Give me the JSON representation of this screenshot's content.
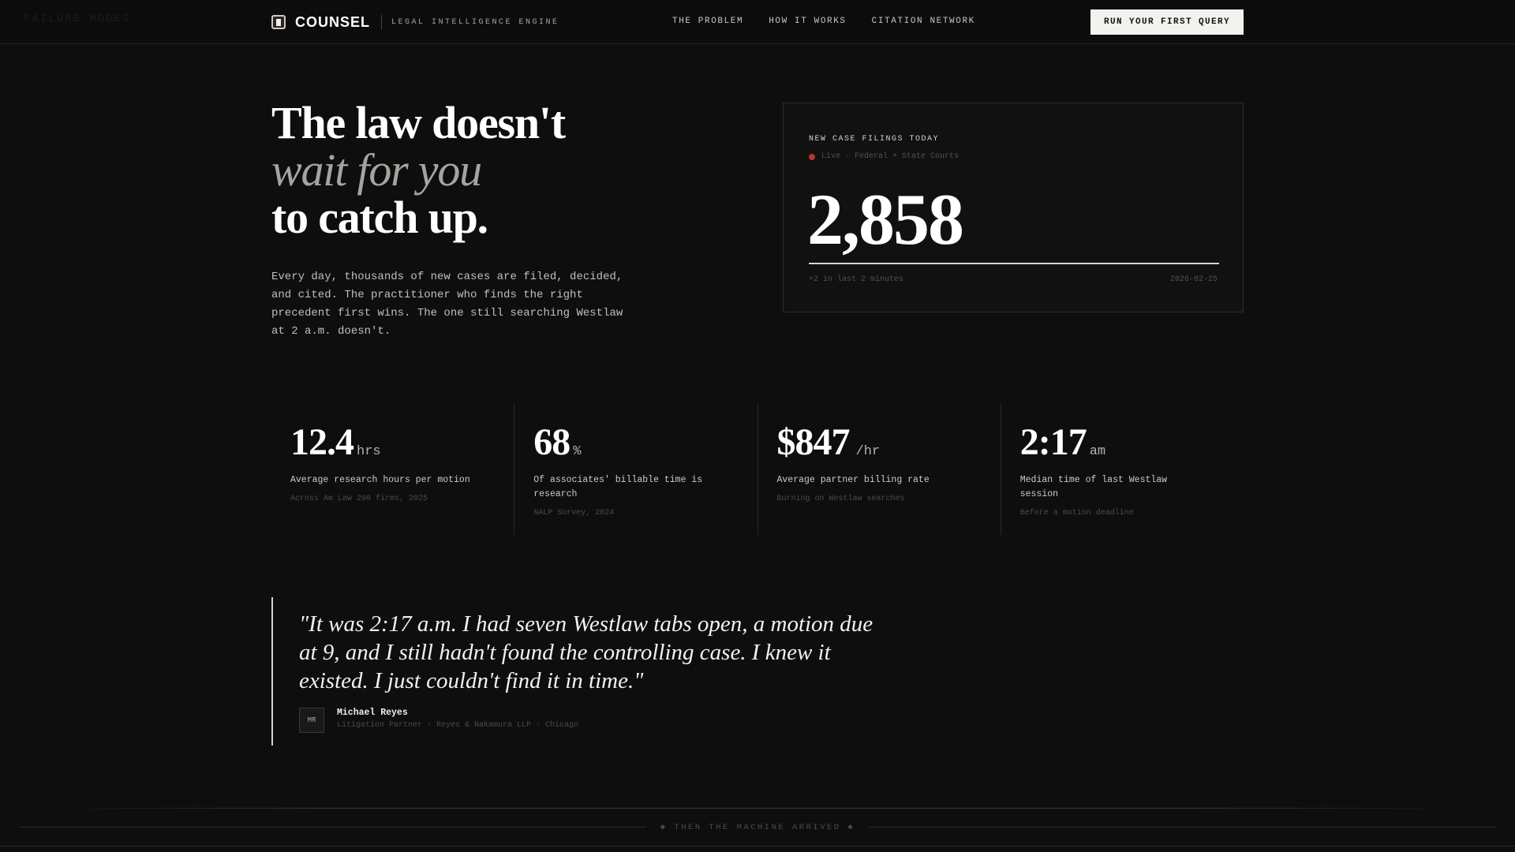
{
  "nav": {
    "ghost_text": "FAILURE MODES",
    "brand_name": "COUNSEL",
    "brand_tagline": "LEGAL INTELLIGENCE ENGINE",
    "links": [
      "THE PROBLEM",
      "HOW IT WORKS",
      "CITATION NETWORK"
    ],
    "cta_label": "RUN YOUR FIRST QUERY"
  },
  "hero": {
    "headline_line1": "The law doesn't",
    "headline_line2": "wait for you",
    "headline_line3": "to catch up.",
    "body": "Every day, thousands of new cases are filed, decided, and cited. The practitioner who finds the right precedent first wins. The one still searching Westlaw at 2 a.m. doesn't."
  },
  "live_card": {
    "label": "NEW CASE FILINGS TODAY",
    "live_text": "Live · Federal + State Courts",
    "count": "2,858",
    "progress_fraction": 1.0,
    "footer_left": "+2 in last 2 minutes",
    "footer_right": "2026-02-25",
    "accent_dot_color": "#b8362d"
  },
  "stats": [
    {
      "value": "12.4",
      "unit": "hrs",
      "desc": "Average research hours per motion",
      "source": "Across Am Law 200 firms, 2025"
    },
    {
      "value": "68",
      "unit": "%",
      "desc": "Of associates' billable time is research",
      "source": "NALP Survey, 2024"
    },
    {
      "value": "$847",
      "unit": "/hr",
      "desc": "Average partner billing rate",
      "source": "Burning on Westlaw searches"
    },
    {
      "value": "2:17",
      "unit": "am",
      "desc": "Median time of last Westlaw session",
      "source": "Before a motion deadline"
    }
  ],
  "quote": {
    "text": "\"It was 2:17 a.m. I had seven Westlaw tabs open, a motion due at 9, and I still hadn't found the controlling case. I knew it existed. I just couldn't find it in time.\"",
    "avatar_initials": "MR",
    "author_name": "Michael Reyes",
    "author_role": "Litigation Partner · Reyes & Nakamura LLP · Chicago"
  },
  "divider": {
    "label": "◆ THEN THE MACHINE ARRIVED ◆"
  }
}
